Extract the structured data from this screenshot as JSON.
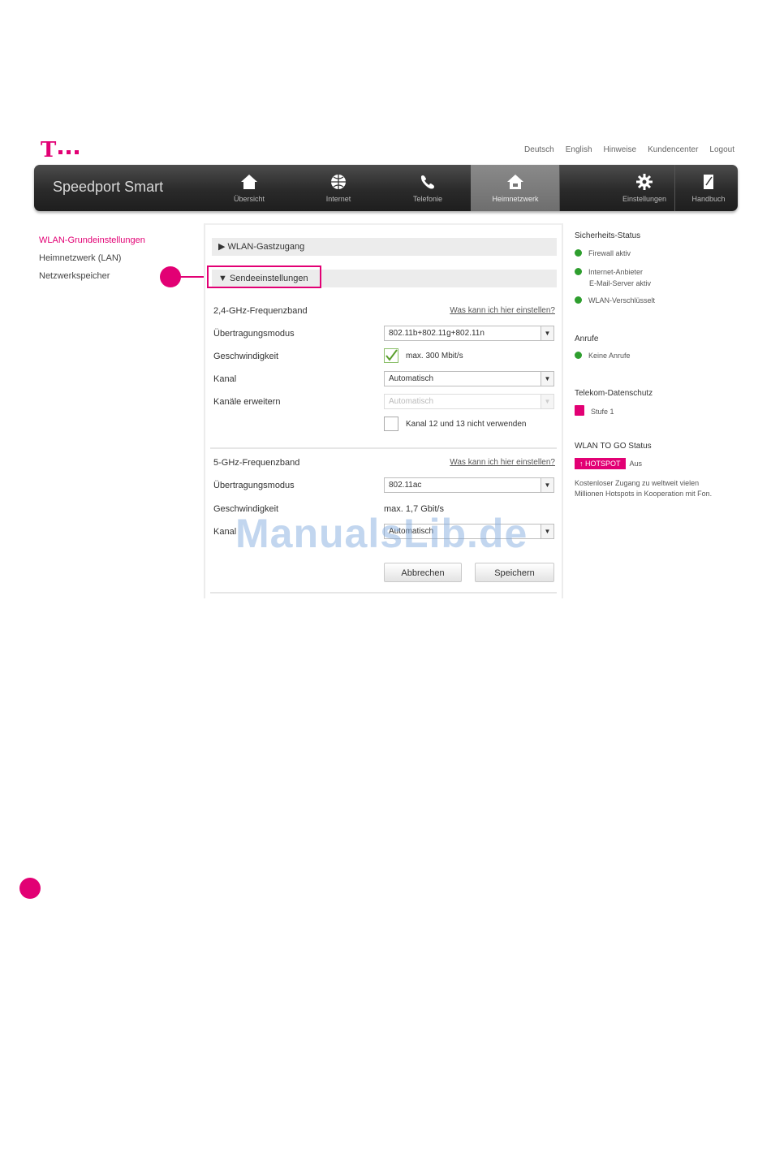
{
  "logo": {
    "letter": "T",
    "name": "Telekom"
  },
  "top_links": [
    "Deutsch",
    "English",
    "Hinweise",
    "Kundencenter",
    "Logout"
  ],
  "nav": {
    "brand": "Speedport Smart",
    "items": [
      {
        "label": "Übersicht",
        "icon": "home-icon"
      },
      {
        "label": "Internet",
        "icon": "globe-icon"
      },
      {
        "label": "Telefonie",
        "icon": "phone-icon"
      },
      {
        "label": "Heimnetzwerk",
        "icon": "house-network-icon",
        "active": true
      },
      {
        "label": "Einstellungen",
        "icon": "gear-icon"
      },
      {
        "label": "Handbuch",
        "icon": "book-icon"
      }
    ]
  },
  "sidemenu": [
    {
      "label": "WLAN-Grundeinstellungen",
      "active": true
    },
    {
      "label": "Heimnetzwerk (LAN)",
      "active": false
    },
    {
      "label": "Netzwerkspeicher",
      "active": false
    }
  ],
  "main": {
    "section1": "WLAN-Gastzugang",
    "section2": "Sendeeinstellungen",
    "band24": {
      "title": "2,4-GHz-Frequenzband",
      "link": "Was kann ich hier einstellen?",
      "mode_label": "Übertragungsmodus",
      "mode_value": "802.11b+802.11g+802.11n",
      "speed_label": "Geschwindigkeit",
      "speed_value": "max. 300 Mbit/s",
      "channel_label": "Kanal",
      "channel_value": "Automatisch",
      "channels_label": "Kanäle erweitern",
      "channels_value": "Automatisch",
      "exclude_label": "Kanal 12 und 13 nicht verwenden"
    },
    "band5": {
      "title": "5-GHz-Frequenzband",
      "link": "Was kann ich hier einstellen?",
      "mode_label": "Übertragungsmodus",
      "mode_value": "802.11ac",
      "speed_label": "Geschwindigkeit",
      "speed_value": "max. 1,7 Gbit/s",
      "channel_label": "Kanal",
      "channel_value": "Automatisch"
    },
    "cancel_label": "Abbrechen",
    "save_label": "Speichern"
  },
  "right": {
    "security_title": "Sicherheits-Status",
    "security_items": [
      "Firewall aktiv",
      "Internet-Anbieter",
      "E-Mail-Server aktiv",
      "WLAN-Verschlüsselt"
    ],
    "anrufe_title": "Anrufe",
    "anrufe_item": "Keine Anrufe",
    "telekom_title": "Telekom-Datenschutz",
    "telekom_item": "Stufe 1",
    "hotspot_title": "WLAN TO GO Status",
    "hotspot_badge": "HOTSPOT",
    "hotspot_state": "Aus",
    "hotspot_desc_1": "Kostenloser Zugang zu weltweit vielen",
    "hotspot_desc_2": "Millionen Hotspots in Kooperation mit Fon."
  },
  "watermark": "ManualsLib.de",
  "colors": {
    "accent": "#e20074",
    "status_ok": "#2e9e2e",
    "nav_dark": "#2a2a2a"
  }
}
